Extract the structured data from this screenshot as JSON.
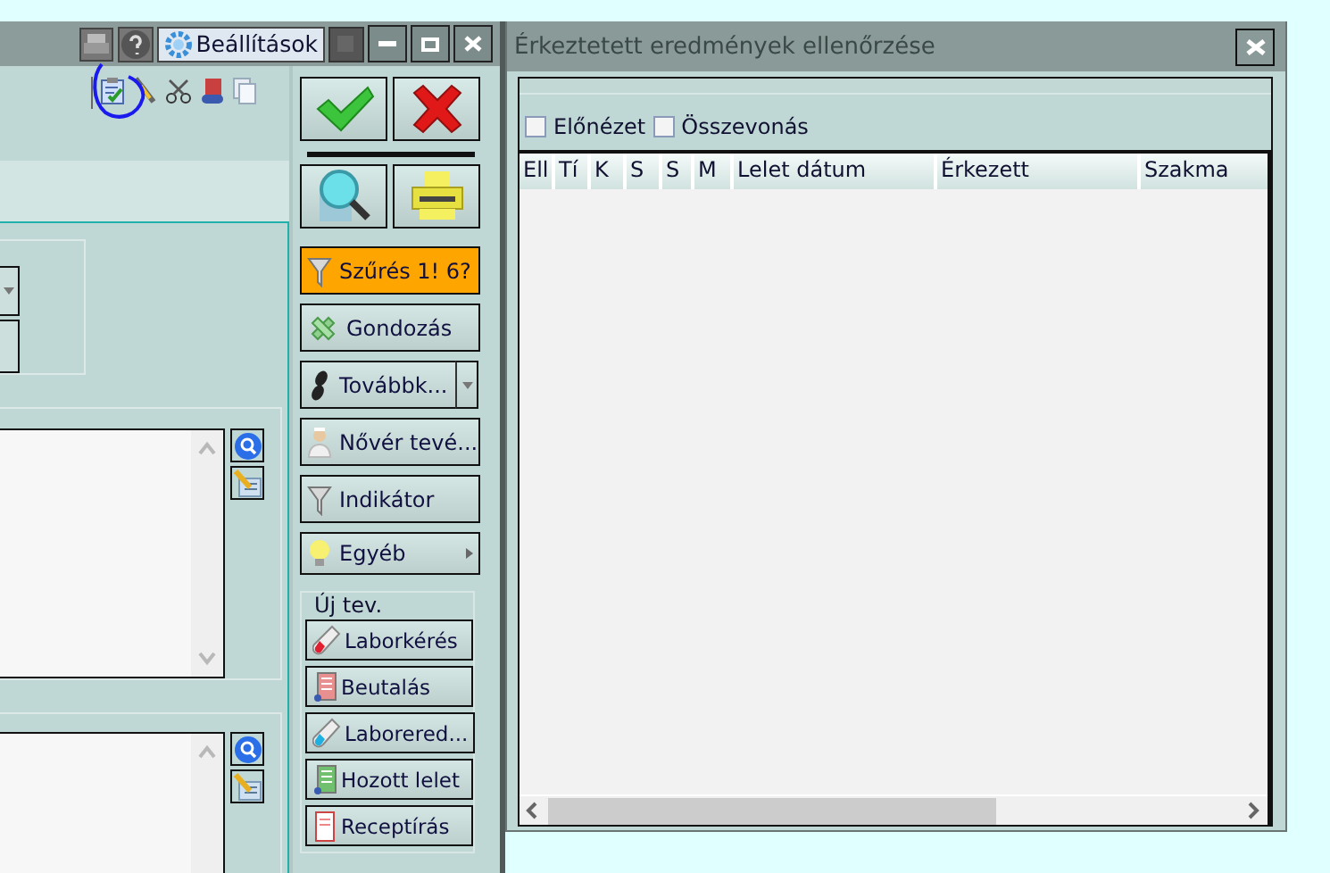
{
  "left_window": {
    "settings_button": "Beállítások",
    "actions": [
      {
        "label": "Szűrés 1! 6?",
        "kind": "plain",
        "highlighted": true
      },
      {
        "label": "Gondozás",
        "kind": "plain",
        "highlighted": false
      },
      {
        "label": "Továbbk...",
        "kind": "split",
        "highlighted": false
      },
      {
        "label": "Nővér tevé...",
        "kind": "plain",
        "highlighted": false
      },
      {
        "label": "Indikátor",
        "kind": "plain",
        "highlighted": false
      },
      {
        "label": "Egyéb",
        "kind": "submenu",
        "highlighted": false
      }
    ],
    "new_activity": {
      "title": "Új tev.",
      "buttons": [
        "Laborkérés",
        "Beutalás",
        "Laborered...",
        "Hozott lelet",
        "Receptírás"
      ]
    }
  },
  "dialog": {
    "title": "Érkeztetett eredmények ellenőrzése",
    "options": [
      {
        "label": "Előnézet",
        "checked": false
      },
      {
        "label": "Összevonás",
        "checked": false
      }
    ],
    "table": {
      "columns": [
        "Ell",
        "Tí",
        "K",
        "S",
        "S",
        "M",
        "Lelet dátum",
        "Érkezett",
        "Szakma"
      ]
    }
  }
}
